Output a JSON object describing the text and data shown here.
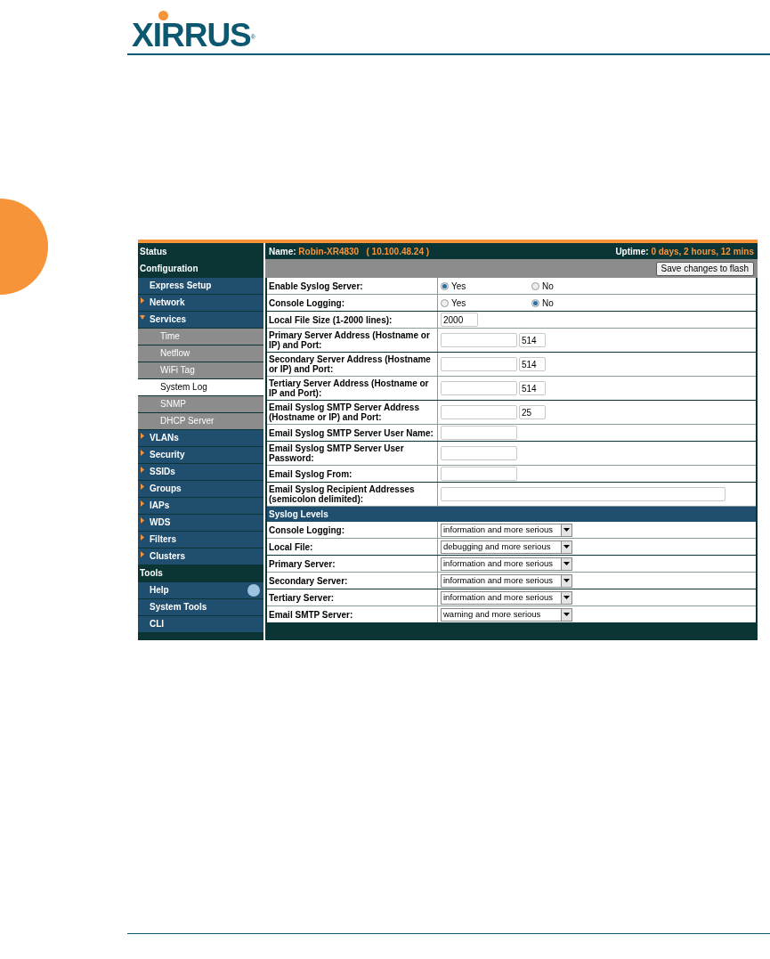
{
  "logo": {
    "text": "XIRRUS",
    "mark": "®"
  },
  "sidebar": [
    {
      "label": "Status",
      "kind": "header"
    },
    {
      "label": "Configuration",
      "kind": "header"
    },
    {
      "label": "Express Setup",
      "kind": "item"
    },
    {
      "label": "Network",
      "kind": "item",
      "expanded": false
    },
    {
      "label": "Services",
      "kind": "item",
      "expanded": true,
      "children": [
        {
          "label": "Time",
          "selected": false
        },
        {
          "label": "Netflow",
          "selected": false
        },
        {
          "label": "WiFi Tag",
          "selected": false
        },
        {
          "label": "System Log",
          "selected": true
        },
        {
          "label": "SNMP",
          "selected": false
        },
        {
          "label": "DHCP Server",
          "selected": false
        }
      ]
    },
    {
      "label": "VLANs",
      "kind": "item",
      "expanded": false
    },
    {
      "label": "Security",
      "kind": "item",
      "expanded": false
    },
    {
      "label": "SSIDs",
      "kind": "item",
      "expanded": false
    },
    {
      "label": "Groups",
      "kind": "item",
      "expanded": false
    },
    {
      "label": "IAPs",
      "kind": "item",
      "expanded": false
    },
    {
      "label": "WDS",
      "kind": "item",
      "expanded": false
    },
    {
      "label": "Filters",
      "kind": "item",
      "expanded": false
    },
    {
      "label": "Clusters",
      "kind": "item",
      "expanded": false
    },
    {
      "label": "Tools",
      "kind": "header"
    },
    {
      "label": "Help",
      "kind": "item",
      "help": true
    },
    {
      "label": "System Tools",
      "kind": "item"
    },
    {
      "label": "CLI",
      "kind": "item"
    }
  ],
  "header": {
    "name_label": "Name:",
    "name": "Robin-XR4830   ( 10.100.48.24 )",
    "uptime_label": "Uptime:",
    "uptime": "0 days, 2 hours, 12 mins"
  },
  "save_button": "Save changes to flash",
  "form": [
    {
      "kind": "radio",
      "label": "Enable Syslog Server:",
      "options": [
        {
          "label": "Yes",
          "selected": true
        },
        {
          "label": "No",
          "selected": false
        }
      ]
    },
    {
      "kind": "radio",
      "label": "Console Logging:",
      "options": [
        {
          "label": "Yes",
          "selected": false
        },
        {
          "label": "No",
          "selected": true
        }
      ]
    },
    {
      "kind": "input",
      "label": "Local File Size (1-2000 lines):",
      "value": "2000"
    },
    {
      "kind": "address",
      "label": "Primary Server Address (Hostname or IP) and Port:",
      "port": "514"
    },
    {
      "kind": "address",
      "label": "Secondary Server Address (Hostname or IP) and Port:",
      "port": "514"
    },
    {
      "kind": "address",
      "label": "Tertiary Server Address (Hostname or IP and Port):",
      "port": "514"
    },
    {
      "kind": "address",
      "label": "Email Syslog SMTP Server Address (Hostname or IP) and Port:",
      "port": "25"
    },
    {
      "kind": "text",
      "label": "Email Syslog SMTP Server User Name:"
    },
    {
      "kind": "text",
      "label": "Email Syslog SMTP Server User Password:"
    },
    {
      "kind": "text",
      "label": "Email Syslog From:"
    },
    {
      "kind": "wide",
      "label": "Email Syslog Recipient Addresses (semicolon delimited):"
    },
    {
      "kind": "section",
      "label": "Syslog Levels"
    },
    {
      "kind": "select",
      "label": "Console Logging:",
      "value": "information and more serious"
    },
    {
      "kind": "select",
      "label": "Local File:",
      "value": "debugging and more serious"
    },
    {
      "kind": "select",
      "label": "Primary Server:",
      "value": "information and more serious"
    },
    {
      "kind": "select",
      "label": "Secondary Server:",
      "value": "information and more serious"
    },
    {
      "kind": "select",
      "label": "Tertiary Server:",
      "value": "information and more serious"
    },
    {
      "kind": "select",
      "label": "Email SMTP Server:",
      "value": "warning and more serious"
    }
  ]
}
